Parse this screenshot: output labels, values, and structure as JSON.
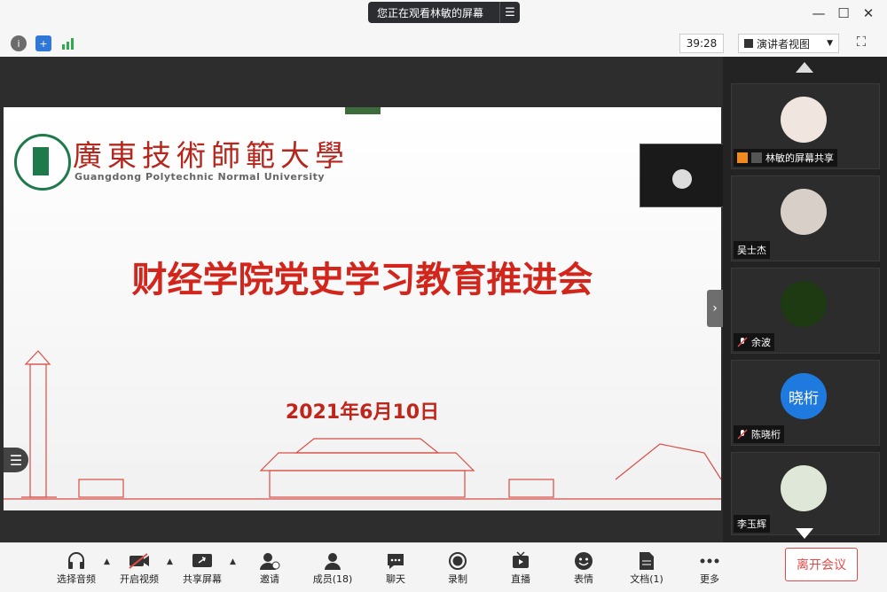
{
  "title_bar": {
    "viewing_text": "您正在观看林敏的屏幕",
    "menu_icon": "list-menu-icon",
    "window_controls": [
      "minimize-icon",
      "maximize-icon",
      "close-icon"
    ]
  },
  "toolbar": {
    "info_icon": "info-icon",
    "security_icon": "shield-icon",
    "signal_icon": "signal-bars-icon",
    "timer": "39:28",
    "view_mode": "演讲者视图",
    "fullscreen_icon": "fullscreen-icon"
  },
  "slide": {
    "university_cn": "廣東技術師範大學",
    "university_en": "Guangdong Polytechnic Normal University",
    "title": "财经学院党史学习教育推进会",
    "date": "2021年6月10日",
    "colors": {
      "red": "#d2261c",
      "green": "#1e7a4a"
    }
  },
  "participants": [
    {
      "name": "林敏的屏幕共享",
      "avatar": "cartoon-girl",
      "muted": false
    },
    {
      "name": "吴士杰",
      "avatar": "photo-man",
      "muted": false
    },
    {
      "name": "余波",
      "avatar": "clover-photo",
      "muted": true
    },
    {
      "name": "陈晓桁",
      "avatar_text": "晓桁",
      "muted": true
    },
    {
      "name": "李玉辉",
      "avatar": "plant-photo",
      "muted": false
    }
  ],
  "bottom_bar": {
    "buttons": [
      {
        "label": "选择音频",
        "icon": "headset-icon"
      },
      {
        "label": "开启视频",
        "icon": "video-off-icon"
      },
      {
        "label": "共享屏幕",
        "icon": "share-screen-icon"
      },
      {
        "label": "邀请",
        "icon": "invite-user-icon"
      },
      {
        "label": "成员(18)",
        "icon": "members-icon"
      },
      {
        "label": "聊天",
        "icon": "chat-icon"
      },
      {
        "label": "录制",
        "icon": "record-icon"
      },
      {
        "label": "直播",
        "icon": "live-icon"
      },
      {
        "label": "表情",
        "icon": "emoji-icon"
      },
      {
        "label": "文档(1)",
        "icon": "document-icon"
      },
      {
        "label": "更多",
        "icon": "more-icon"
      }
    ],
    "leave": "离开会议",
    "leave_color": "#e04b4b"
  }
}
